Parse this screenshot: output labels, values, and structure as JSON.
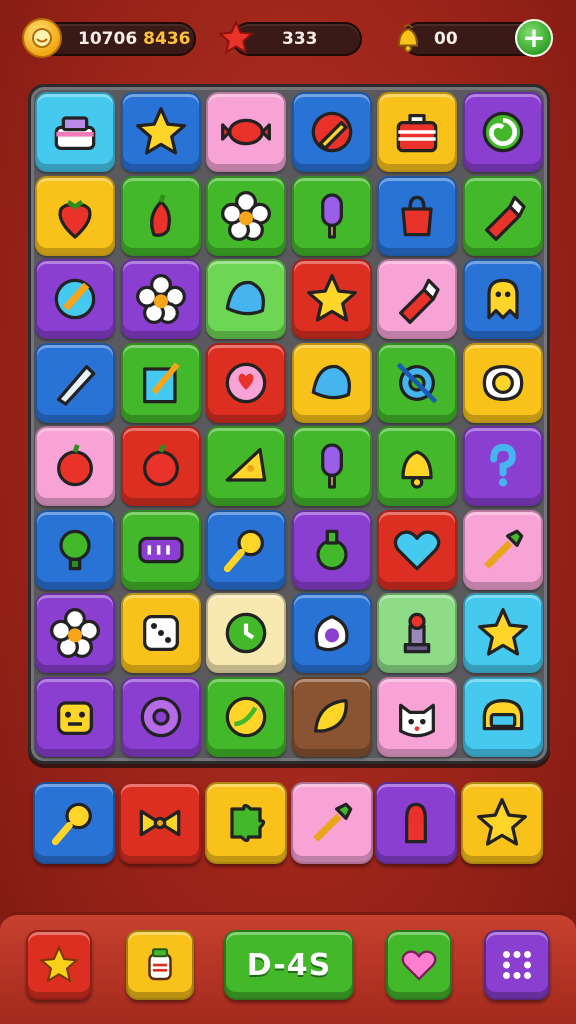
{
  "hud": {
    "coins_value": "10706",
    "coins_extra": "8436",
    "stars_value": "333",
    "bells_value": "00",
    "add_label": "+"
  },
  "board": {
    "rows": [
      [
        {
          "color": "cyan",
          "icon": "cake-icon"
        },
        {
          "color": "blue",
          "icon": "star-icon"
        },
        {
          "color": "pink",
          "icon": "candy-icon"
        },
        {
          "color": "blue",
          "icon": "pencil-icon"
        },
        {
          "color": "yellow",
          "icon": "box-icon"
        },
        {
          "color": "purple",
          "icon": "swirl-icon"
        }
      ],
      [
        {
          "color": "yellow",
          "icon": "strawberry-icon"
        },
        {
          "color": "green",
          "icon": "chili-icon"
        },
        {
          "color": "green",
          "icon": "flower-icon"
        },
        {
          "color": "green",
          "icon": "popsicle-icon"
        },
        {
          "color": "blue",
          "icon": "bag-icon"
        },
        {
          "color": "green",
          "icon": "crayon-icon"
        }
      ],
      [
        {
          "color": "purple",
          "icon": "paintbrush-icon"
        },
        {
          "color": "purple",
          "icon": "flower-icon"
        },
        {
          "color": "lgreen",
          "icon": "shell-icon"
        },
        {
          "color": "red",
          "icon": "star-icon"
        },
        {
          "color": "pink",
          "icon": "crayon-icon"
        },
        {
          "color": "blue",
          "icon": "ghost-icon"
        }
      ],
      [
        {
          "color": "blue",
          "icon": "pen-icon"
        },
        {
          "color": "green",
          "icon": "notepad-icon"
        },
        {
          "color": "red",
          "icon": "sun-icon"
        },
        {
          "color": "yellow",
          "icon": "shell-icon"
        },
        {
          "color": "green",
          "icon": "gear-icon"
        },
        {
          "color": "yellow",
          "icon": "egg-icon"
        }
      ],
      [
        {
          "color": "pink",
          "icon": "apple-icon"
        },
        {
          "color": "red",
          "icon": "apple-icon"
        },
        {
          "color": "green",
          "icon": "cheese-icon"
        },
        {
          "color": "green",
          "icon": "popsicle-icon"
        },
        {
          "color": "green",
          "icon": "bell-icon"
        },
        {
          "color": "purple",
          "icon": "question-icon"
        }
      ],
      [
        {
          "color": "blue",
          "icon": "bulb-icon"
        },
        {
          "color": "green",
          "icon": "battery-icon"
        },
        {
          "color": "blue",
          "icon": "magnifier-icon"
        },
        {
          "color": "purple",
          "icon": "potion-icon"
        },
        {
          "color": "red",
          "icon": "heart-icon"
        },
        {
          "color": "pink",
          "icon": "brush-icon"
        }
      ],
      [
        {
          "color": "purple",
          "icon": "flower-icon"
        },
        {
          "color": "yellow",
          "icon": "dice-icon"
        },
        {
          "color": "cream",
          "icon": "clock-icon"
        },
        {
          "color": "blue",
          "icon": "eye-icon"
        },
        {
          "color": "mint",
          "icon": "chess-icon"
        },
        {
          "color": "cyan",
          "icon": "star-icon"
        }
      ],
      [
        {
          "color": "purple",
          "icon": "robot-icon"
        },
        {
          "color": "purple",
          "icon": "donut-icon"
        },
        {
          "color": "green",
          "icon": "banana-icon"
        },
        {
          "color": "brown",
          "icon": "leaf-icon"
        },
        {
          "color": "pink",
          "icon": "cat-icon"
        },
        {
          "color": "cyan",
          "icon": "helmet-icon"
        }
      ]
    ]
  },
  "tray": [
    {
      "color": "blue",
      "icon": "magnifier-icon"
    },
    {
      "color": "red",
      "icon": "bow-icon"
    },
    {
      "color": "yellow",
      "icon": "puzzle-icon"
    },
    {
      "color": "pink",
      "icon": "brush-icon"
    },
    {
      "color": "purple",
      "icon": "glove-icon"
    },
    {
      "color": "yellow",
      "icon": "star-icon"
    }
  ],
  "bottom": {
    "play_label": "D-4S"
  },
  "colors": {
    "cyan": "#45c9ef",
    "blue": "#2a73d6",
    "pink": "#f7a3d6",
    "yellow": "#f8c21a",
    "purple": "#8a3fd1",
    "green": "#43b82b",
    "lgreen": "#6ed655",
    "red": "#dc2f22",
    "cream": "#f7e9b0",
    "brown": "#8a5432",
    "mint": "#8fdc88"
  }
}
